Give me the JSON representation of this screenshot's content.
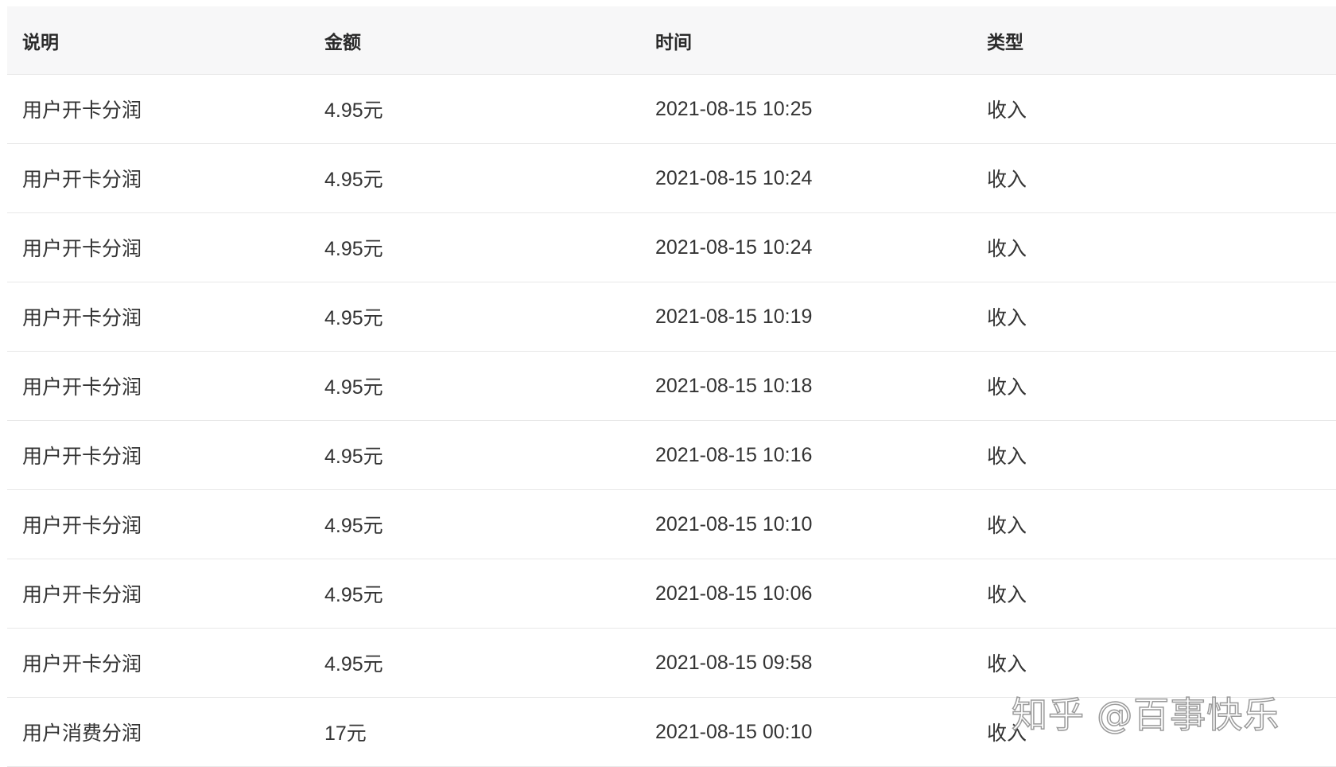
{
  "columns": [
    "说明",
    "金额",
    "时间",
    "类型"
  ],
  "rows": [
    {
      "desc": "用户开卡分润",
      "amount": "4.95元",
      "time": "2021-08-15 10:25",
      "type": "收入"
    },
    {
      "desc": "用户开卡分润",
      "amount": "4.95元",
      "time": "2021-08-15 10:24",
      "type": "收入"
    },
    {
      "desc": "用户开卡分润",
      "amount": "4.95元",
      "time": "2021-08-15 10:24",
      "type": "收入"
    },
    {
      "desc": "用户开卡分润",
      "amount": "4.95元",
      "time": "2021-08-15 10:19",
      "type": "收入"
    },
    {
      "desc": "用户开卡分润",
      "amount": "4.95元",
      "time": "2021-08-15 10:18",
      "type": "收入"
    },
    {
      "desc": "用户开卡分润",
      "amount": "4.95元",
      "time": "2021-08-15 10:16",
      "type": "收入"
    },
    {
      "desc": "用户开卡分润",
      "amount": "4.95元",
      "time": "2021-08-15 10:10",
      "type": "收入"
    },
    {
      "desc": "用户开卡分润",
      "amount": "4.95元",
      "time": "2021-08-15 10:06",
      "type": "收入"
    },
    {
      "desc": "用户开卡分润",
      "amount": "4.95元",
      "time": "2021-08-15 09:58",
      "type": "收入"
    },
    {
      "desc": "用户消费分润",
      "amount": "17元",
      "time": "2021-08-15 00:10",
      "type": "收入"
    }
  ],
  "watermark": "知乎 @百事快乐"
}
